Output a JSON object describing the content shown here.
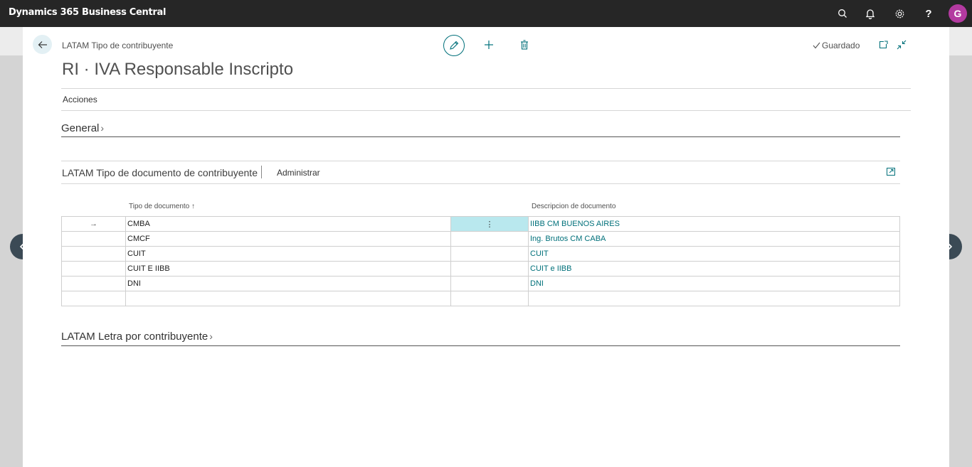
{
  "app": {
    "title": "Dynamics 365 Business Central",
    "user_initial": "G",
    "accent": "#00707a"
  },
  "page": {
    "breadcrumb": "LATAM Tipo de contribuyente",
    "title": "RI · IVA Responsable Inscripto",
    "saved_status": "Guardado",
    "actions_label": "Acciones"
  },
  "fasttabs": {
    "general": "General",
    "letters": "LATAM Letra por contribuyente"
  },
  "subpage": {
    "title": "LATAM Tipo de documento de contribuyente",
    "manage_label": "Administrar",
    "columns": {
      "doc_type": "Tipo de documento ↑",
      "description": "Descripcion de documento"
    },
    "rows": [
      {
        "code": "CMBA",
        "description": "IIBB CM BUENOS AIRES"
      },
      {
        "code": "CMCF",
        "description": "Ing. Brutos CM CABA"
      },
      {
        "code": "CUIT",
        "description": "CUIT"
      },
      {
        "code": "CUIT E IIBB",
        "description": "CUIT e IIBB"
      },
      {
        "code": "DNI",
        "description": "DNI"
      }
    ]
  }
}
